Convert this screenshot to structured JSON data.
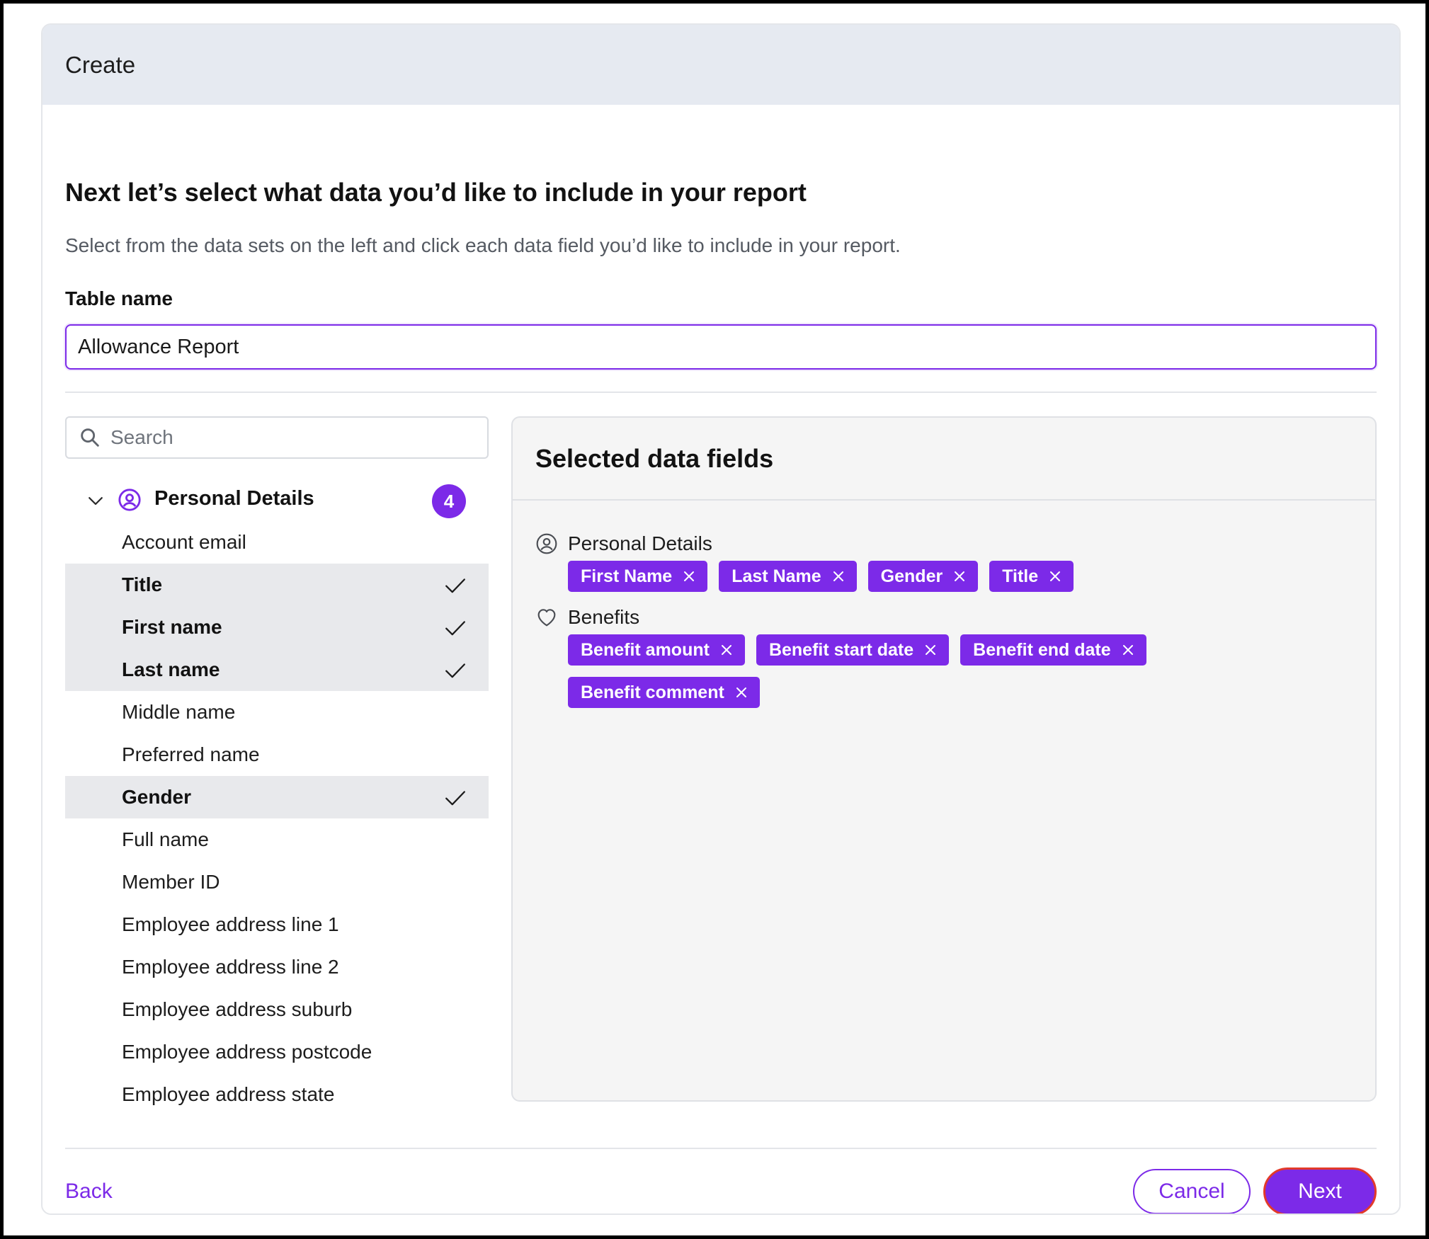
{
  "header": {
    "title": "Create"
  },
  "intro": {
    "headline": "Next let’s select what data you’d like to include in your report",
    "subtext": "Select from the data sets on the left and click each data field you’d like to include in your report."
  },
  "table_name": {
    "label": "Table name",
    "value": "Allowance Report"
  },
  "search": {
    "placeholder": "Search"
  },
  "data_set": {
    "label": "Personal Details",
    "count": "4",
    "fields": [
      {
        "label": "Account email",
        "selected": false
      },
      {
        "label": "Title",
        "selected": true
      },
      {
        "label": "First name",
        "selected": true
      },
      {
        "label": "Last name",
        "selected": true
      },
      {
        "label": "Middle name",
        "selected": false
      },
      {
        "label": "Preferred name",
        "selected": false
      },
      {
        "label": "Gender",
        "selected": true
      },
      {
        "label": "Full name",
        "selected": false
      },
      {
        "label": "Member ID",
        "selected": false
      },
      {
        "label": "Employee address line 1",
        "selected": false
      },
      {
        "label": "Employee address line 2",
        "selected": false
      },
      {
        "label": "Employee address suburb",
        "selected": false
      },
      {
        "label": "Employee address postcode",
        "selected": false
      },
      {
        "label": "Employee address state",
        "selected": false
      }
    ]
  },
  "selected_panel": {
    "title": "Selected data fields",
    "sections": [
      {
        "label": "Personal Details",
        "icon": "user-circle-icon",
        "chips": [
          "First Name",
          "Last Name",
          "Gender",
          "Title"
        ]
      },
      {
        "label": "Benefits",
        "icon": "heart-icon",
        "chips": [
          "Benefit amount",
          "Benefit start date",
          "Benefit end date",
          "Benefit comment"
        ]
      }
    ]
  },
  "footer": {
    "back_label": "Back",
    "cancel_label": "Cancel",
    "next_label": "Next"
  },
  "colors": {
    "accent": "#7c2ae8",
    "header_bg": "#e6eaf1",
    "selected_row_bg": "#e8e9ec",
    "next_outline": "#e23a2b"
  }
}
